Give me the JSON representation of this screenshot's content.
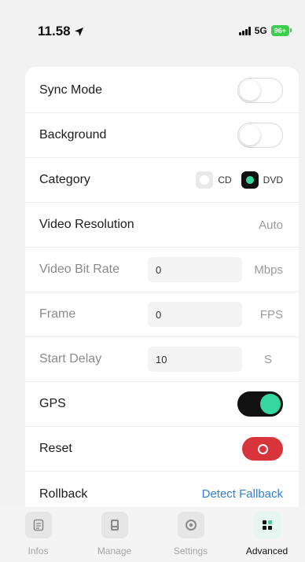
{
  "status": {
    "time": "11.58",
    "network": "5G",
    "battery": "96+"
  },
  "rows": {
    "sync_mode": {
      "label": "Sync Mode",
      "on": false
    },
    "background": {
      "label": "Background",
      "on": false
    },
    "category": {
      "label": "Category",
      "options": [
        "CD",
        "DVD"
      ],
      "selected": "DVD"
    },
    "video_resolution": {
      "label": "Video Resolution",
      "value": "Auto"
    },
    "video_bit_rate": {
      "label": "Video Bit Rate",
      "value": "0",
      "unit": "Mbps"
    },
    "frame": {
      "label": "Frame",
      "value": "0",
      "unit": "FPS"
    },
    "start_delay": {
      "label": "Start Delay",
      "value": "10",
      "unit": "S"
    },
    "gps": {
      "label": "GPS",
      "on": true
    },
    "reset": {
      "label": "Reset"
    },
    "rollback": {
      "label": "Rollback",
      "action": "Detect Fallback"
    }
  },
  "tabs": [
    {
      "label": "Infos",
      "icon": "document-icon",
      "active": false
    },
    {
      "label": "Manage",
      "icon": "device-icon",
      "active": false
    },
    {
      "label": "Settings",
      "icon": "gear-icon",
      "active": false
    },
    {
      "label": "Advanced",
      "icon": "grid-icon",
      "active": true
    }
  ],
  "colors": {
    "accent": "#36d6a0",
    "danger": "#d8343c",
    "link": "#2f7fd8"
  }
}
